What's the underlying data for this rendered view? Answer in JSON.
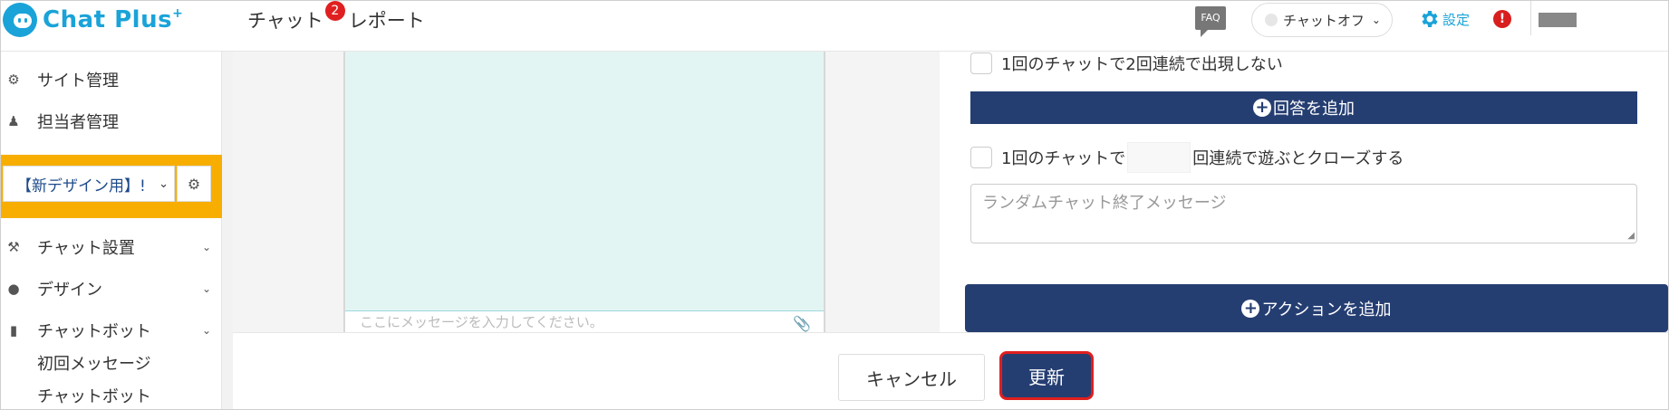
{
  "header": {
    "logo_text": "Chat Plus",
    "logo_sup": "+",
    "nav": [
      {
        "label": "チャット",
        "badge": "2"
      },
      {
        "label": "レポート"
      }
    ],
    "faq_label": "FAQ",
    "chat_toggle_label": "チャットオフ",
    "settings_label": "設定",
    "alert_label": "!"
  },
  "sidebar": {
    "items": [
      {
        "label": "サイト管理",
        "icon": "gear-icon"
      },
      {
        "label": "担当者管理",
        "icon": "users-icon"
      }
    ],
    "site_select_value": "【新デザイン用】!",
    "sections": [
      {
        "label": "チャット設置",
        "icon": "tools-icon"
      },
      {
        "label": "デザイン",
        "icon": "palette-icon"
      },
      {
        "label": "チャットボット",
        "icon": "chat-icon"
      }
    ],
    "sub_items": [
      "初回メッセージ",
      "チャットボット"
    ]
  },
  "preview": {
    "input_placeholder": "ここにメッセージを入力してください。"
  },
  "form": {
    "checkbox1_label": "1回のチャットで2回連続で出現しない",
    "add_answer_label": "回答を追加",
    "checkbox2_prefix": "1回のチャットで",
    "checkbox2_suffix": "回連続で遊ぶとクローズする",
    "end_message_placeholder": "ランダムチャット終了メッセージ",
    "add_action_label": "アクションを追加"
  },
  "footer": {
    "cancel_label": "キャンセル",
    "update_label": "更新"
  },
  "colors": {
    "brand": "#1aa3d8",
    "navy": "#253e72",
    "highlight": "#f7ae00",
    "alert": "#e01f1f"
  }
}
